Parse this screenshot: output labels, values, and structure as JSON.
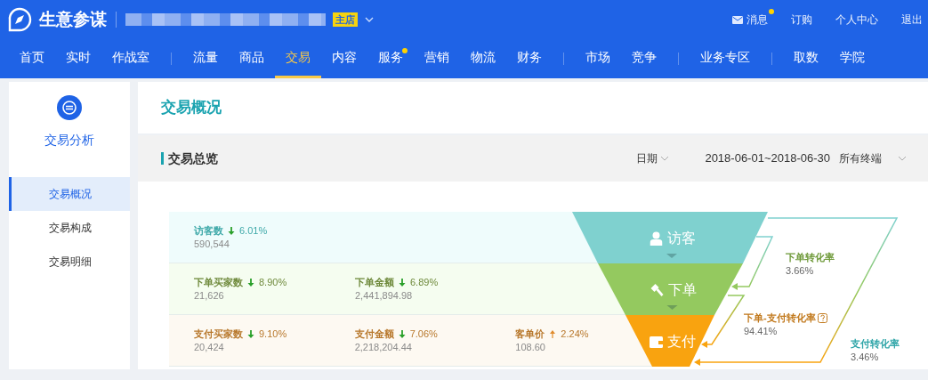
{
  "header": {
    "title": "生意参谋",
    "store_badge": "主店",
    "links": [
      {
        "label": "消息",
        "kind": "mail",
        "dot": true
      },
      {
        "label": "订购",
        "kind": "plain",
        "dot": false
      },
      {
        "label": "个人中心",
        "kind": "plain",
        "dot": false
      },
      {
        "label": "退出",
        "kind": "plain",
        "dot": false
      }
    ]
  },
  "nav": [
    {
      "items": [
        {
          "label": "首页",
          "selected": false,
          "dot": false
        },
        {
          "label": "实时",
          "selected": false,
          "dot": false
        },
        {
          "label": "作战室",
          "selected": false,
          "dot": false
        }
      ]
    },
    {
      "items": [
        {
          "label": "流量",
          "selected": false,
          "dot": false
        },
        {
          "label": "商品",
          "selected": false,
          "dot": false
        },
        {
          "label": "交易",
          "selected": true,
          "dot": false
        },
        {
          "label": "内容",
          "selected": false,
          "dot": false
        },
        {
          "label": "服务",
          "selected": false,
          "dot": true
        },
        {
          "label": "营销",
          "selected": false,
          "dot": false
        },
        {
          "label": "物流",
          "selected": false,
          "dot": false
        },
        {
          "label": "财务",
          "selected": false,
          "dot": false
        }
      ]
    },
    {
      "items": [
        {
          "label": "市场",
          "selected": false,
          "dot": false
        },
        {
          "label": "竞争",
          "selected": false,
          "dot": false
        }
      ]
    },
    {
      "items": [
        {
          "label": "业务专区",
          "selected": false,
          "dot": false
        }
      ]
    },
    {
      "items": [
        {
          "label": "取数",
          "selected": false,
          "dot": false
        },
        {
          "label": "学院",
          "selected": false,
          "dot": false
        }
      ]
    }
  ],
  "sidebar": {
    "title": "交易分析",
    "items": [
      {
        "label": "交易概况",
        "selected": true
      },
      {
        "label": "交易构成",
        "selected": false
      },
      {
        "label": "交易明细",
        "selected": false
      }
    ]
  },
  "page_title": "交易概况",
  "section": {
    "title": "交易总览",
    "period_label": "日期",
    "date_range": "2018-06-01~2018-06-30",
    "terminal": "所有终端"
  },
  "stages": [
    {
      "color": "#3fa9a9",
      "metrics": [
        {
          "label": "访客数",
          "rising": false,
          "change": "6.01%",
          "value": "590,544"
        }
      ]
    },
    {
      "color": "#6f8a3c",
      "metrics": [
        {
          "label": "下单买家数",
          "rising": false,
          "change": "8.90%",
          "value": "21,626"
        },
        {
          "label": "下单金额",
          "rising": false,
          "change": "6.89%",
          "value": "2,441,894.98"
        }
      ]
    },
    {
      "color": "#b8782c",
      "metrics": [
        {
          "label": "支付买家数",
          "rising": false,
          "change": "9.10%",
          "value": "20,424"
        },
        {
          "label": "支付金额",
          "rising": false,
          "change": "7.06%",
          "value": "2,218,204.44"
        },
        {
          "label": "客单价",
          "rising": true,
          "change": "2.24%",
          "value": "108.60"
        }
      ]
    }
  ],
  "funnel": [
    {
      "label": "访客",
      "kind": "visitor",
      "color": "#7fd1cf"
    },
    {
      "label": "下单",
      "kind": "order",
      "color": "#94c95f"
    },
    {
      "label": "支付",
      "kind": "pay",
      "color": "#f9a30f"
    }
  ],
  "conversions": [
    {
      "label": "下单转化率",
      "value": "3.66%",
      "color": "#6f9a3a",
      "help": false
    },
    {
      "label": "下单-支付转化率",
      "value": "94.41%",
      "color": "#c27a1e",
      "help": true
    },
    {
      "label": "支付转化率",
      "value": "3.46%",
      "color": "#2fa5a8",
      "help": false
    }
  ]
}
